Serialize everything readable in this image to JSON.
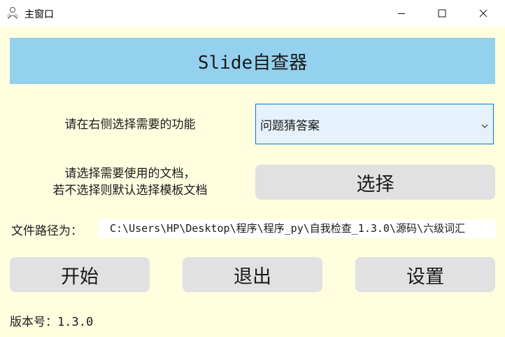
{
  "window": {
    "title": "主窗口"
  },
  "banner": {
    "title": "Slide自查器"
  },
  "function_select": {
    "label": "请在右侧选择需要的功能",
    "selected": "问题猜答案"
  },
  "document": {
    "label_line1": "请选择需要使用的文档，",
    "label_line2": "若不选择则默认选择模板文档",
    "choose_button": "选择"
  },
  "path": {
    "label": "文件路径为：",
    "value": "C:\\Users\\HP\\Desktop\\程序\\程序_py\\自我检查_1.3.0\\源码\\六级词汇"
  },
  "actions": {
    "start": "开始",
    "exit": "退出",
    "settings": "设置"
  },
  "version": {
    "label": "版本号：",
    "value": "1.3.0"
  },
  "icons": {
    "app": "app-icon",
    "minimize": "minimize-icon",
    "maximize": "maximize-icon",
    "close": "close-icon",
    "dropdown": "chevron-down-icon"
  },
  "colors": {
    "background": "#ffffe0",
    "banner": "#93d1ef",
    "button": "#e1e1e1",
    "select_bg": "#e5f1fb",
    "select_border": "#0078d7"
  }
}
